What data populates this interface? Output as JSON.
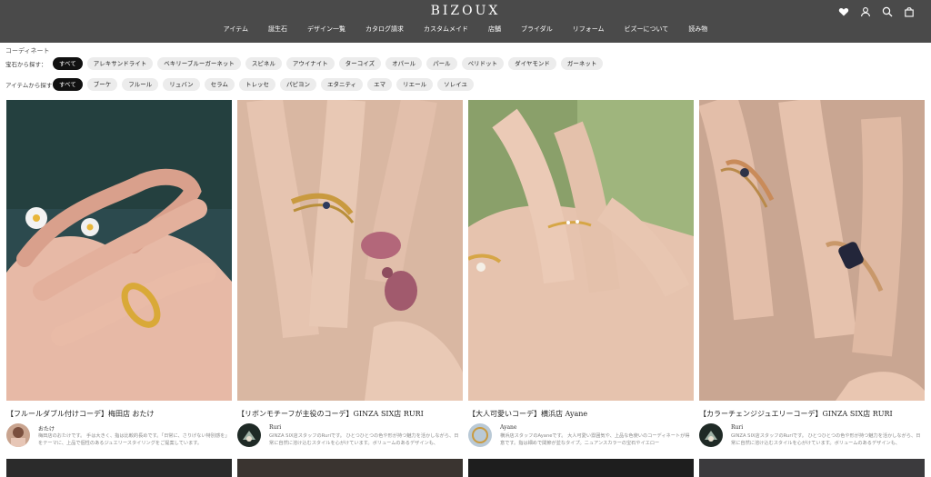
{
  "header": {
    "logo": "BIZOUX",
    "nav": [
      "アイテム",
      "誕生石",
      "デザイン一覧",
      "カタログ請求",
      "カスタムメイド",
      "店舗",
      "ブライダル",
      "リフォーム",
      "ビズーについて",
      "読み物"
    ],
    "icons": [
      "heart-icon",
      "user-icon",
      "search-icon",
      "bag-icon"
    ]
  },
  "filters": {
    "breadcrumb": "コーディネート",
    "stone_label": "宝石から探す：",
    "stones": [
      "すべて",
      "アレキサンドライト",
      "ベキリーブルーガーネット",
      "スピネル",
      "アウイナイト",
      "ターコイズ",
      "オパール",
      "パール",
      "ペリドット",
      "ダイヤモンド",
      "ガーネット"
    ],
    "item_label": "アイテムから探す：",
    "items": [
      "すべて",
      "ブーケ",
      "フルール",
      "リュバン",
      "セラム",
      "トレッセ",
      "パピヨン",
      "エタニティ",
      "エマ",
      "リエール",
      "ソレイユ"
    ]
  },
  "cards": [
    {
      "title": "【フルールダブル付けコーデ】梅田店 おたけ",
      "author": "おたけ",
      "desc": "梅田店のおたけです。 手は大きく、指は比較的長めです。「日常に、さりげない特別感を」をテーマに、上品で個性のあるジュエリースタイリングをご提案しています。"
    },
    {
      "title": "【リボンモチーフが主役のコーデ】GINZA SIX店 RURI",
      "author": "Ruri",
      "desc": "GINZA SIX店スタッフのRuriです。 ひとつひとつの色や形が持つ魅力を活かしながら、日常に自然に溶け込むスタイルを心がけています。ボリュームのあるデザインも、"
    },
    {
      "title": "【大人可愛いコーデ】横浜店 Ayane",
      "author": "Ayane",
      "desc": "横浜店スタッフのAyaneです。 大人可愛い雰囲気や、上品な色使いのコーディネートが得意です。指は細めで関節が並なタイプ。ニュアンスカラーの宝石やイエロー"
    },
    {
      "title": "【カラーチェンジジュエリーコーデ】GINZA SIX店 RURI",
      "author": "Ruri",
      "desc": "GINZA SIX店スタッフのRuriです。 ひとつひとつの色や形が持つ魅力を活かしながら、日常に自然に溶け込むスタイルを心がけています。ボリュームのあるデザインも、"
    }
  ]
}
